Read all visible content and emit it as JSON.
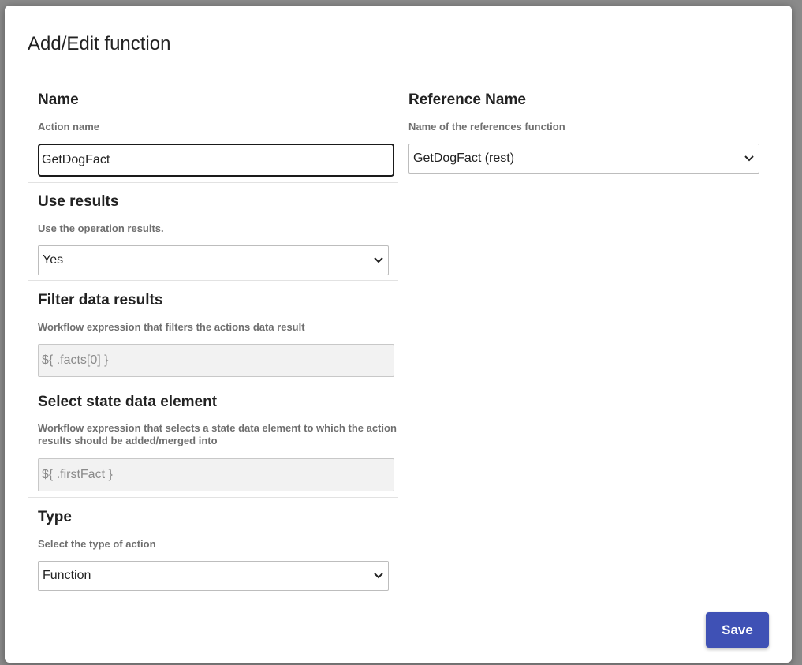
{
  "dialog": {
    "title": "Add/Edit function"
  },
  "name": {
    "label": "Name",
    "help": "Action name",
    "value": "GetDogFact"
  },
  "reference_name": {
    "label": "Reference Name",
    "help": "Name of the references function",
    "selected": "GetDogFact (rest)"
  },
  "use_results": {
    "label": "Use results",
    "help": "Use the operation results.",
    "selected": "Yes"
  },
  "filter_data_results": {
    "label": "Filter data results",
    "help": "Workflow expression that filters the actions data result",
    "placeholder": "${ .facts[0] }"
  },
  "select_state_data_element": {
    "label": "Select state data element",
    "help": "Workflow expression that selects a state data element to which the action results should be added/merged into",
    "placeholder": "${ .firstFact }"
  },
  "type": {
    "label": "Type",
    "help": "Select the type of action",
    "selected": "Function"
  },
  "footer": {
    "save_label": "Save"
  },
  "colors": {
    "primary": "#3f51b5",
    "backdrop": "#8a8a8a"
  },
  "icons": {
    "select_arrow": "chevron-down-icon"
  }
}
